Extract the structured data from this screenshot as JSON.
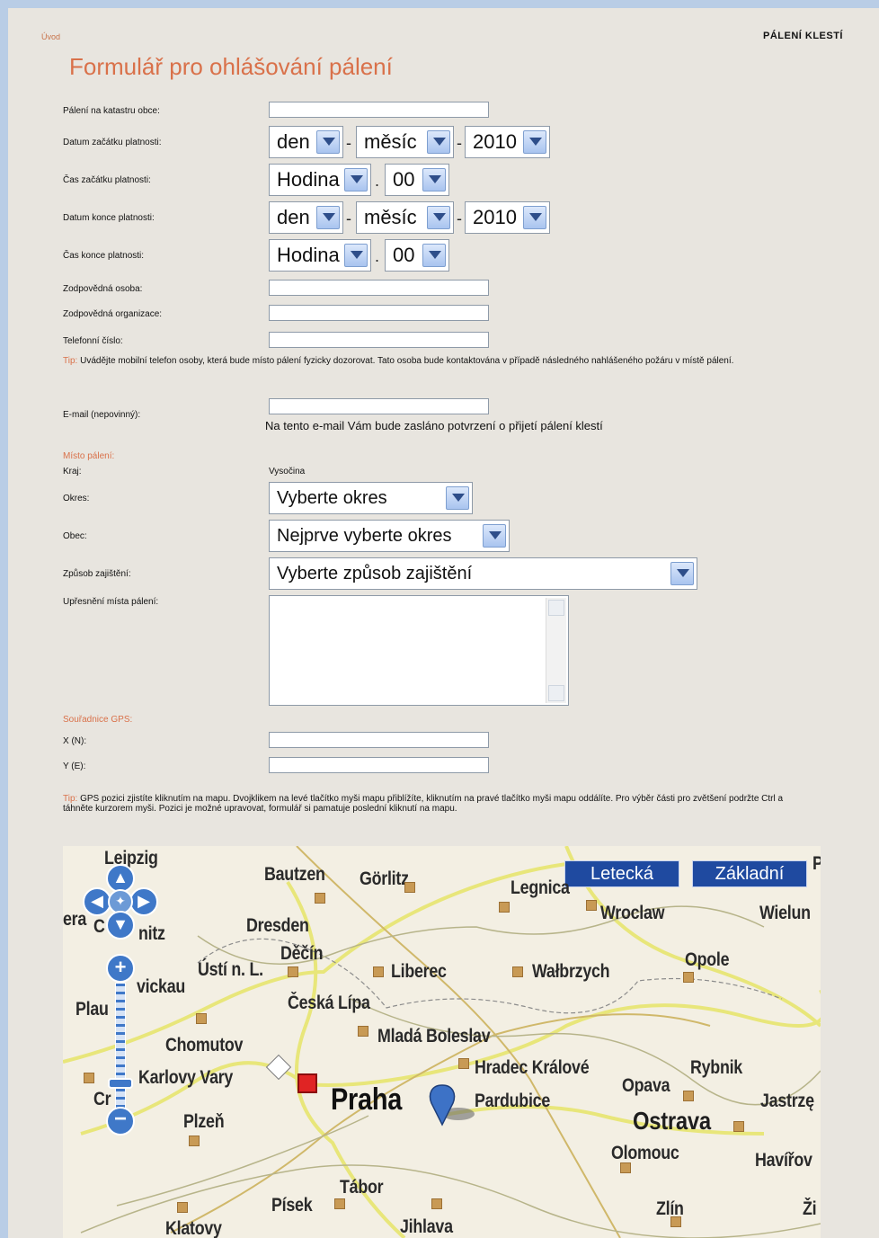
{
  "breadcrumb": "Úvod",
  "header_right": "PÁLENÍ KLESTÍ",
  "title": "Formulář pro ohlášování pálení",
  "labels": {
    "katastr": "Pálení na katastru obce:",
    "datum_zacatku": "Datum začátku platnosti:",
    "cas_zacatku": "Čas začátku platnosti:",
    "datum_konce": "Datum konce platnosti:",
    "cas_konce": "Čas konce platnosti:",
    "osoba": "Zodpovědná osoba:",
    "organizace": "Zodpovědná organizace:",
    "telefon": "Telefonní číslo:",
    "email": "E-mail (nepovinný):",
    "kraj": "Kraj:",
    "okres": "Okres:",
    "obec": "Obec:",
    "zpusob": "Způsob zajištění:",
    "upresneni": "Upřesnění místa pálení:",
    "x": "X (N):",
    "y": "Y (E):"
  },
  "selects": {
    "den": "den",
    "mesic": "měsíc",
    "rok": "2010",
    "hodina": "Hodina",
    "minuta": "00",
    "okres": "Vyberte okres",
    "obec": "Nejprve vyberte okres",
    "zpusob": "Vyberte způsob zajištění"
  },
  "tip_phone": {
    "lead": "Tip:",
    "text": "Uvádějte mobilní telefon osoby, která bude místo pálení fyzicky dozorovat. Tato osoba bude kontaktována v případě následného nahlášeného požáru v místě pálení."
  },
  "email_note": "Na tento e-mail Vám bude zasláno potvrzení o přijetí pálení klestí",
  "section_misto": "Místo pálení:",
  "kraj_value": "Vysočina",
  "section_gps": "Souřadnice GPS:",
  "tip_gps": {
    "lead": "Tip:",
    "text": "GPS pozici zjistíte kliknutím na mapu. Dvojklikem na levé tlačítko myši mapu přiblížíte, kliknutím na pravé tlačítko myši mapu oddálíte. Pro výběr části pro zvětšení podržte Ctrl a táhněte kurzorem myši. Pozici je možné upravovat, formulář si pamatuje poslední kliknutí na mapu."
  },
  "map": {
    "btn_letecka": "Letecká",
    "btn_zakladni": "Základní",
    "cities": [
      "Leipzig",
      "Bautzen",
      "Görlitz",
      "Legnica",
      "Wroclaw",
      "Wielun",
      "Dresden",
      "Děčín",
      "Ústí n. L.",
      "Liberec",
      "Wałbrzych",
      "Opole",
      "Česká Lípa",
      "Mladá Boleslav",
      "Chomutov",
      "Karlovy Vary",
      "Hradec Králové",
      "Rybnik",
      "Praha",
      "Pardubice",
      "Opava",
      "Jastrzę",
      "Plzeň",
      "Ostrava",
      "Olomouc",
      "Havířov",
      "Tábor",
      "Písek",
      "Klatovy",
      "Jihlava",
      "Zlín",
      "Plau",
      "era",
      "Cr",
      "C",
      "P",
      "Ži",
      "vickau",
      "nitz"
    ]
  }
}
